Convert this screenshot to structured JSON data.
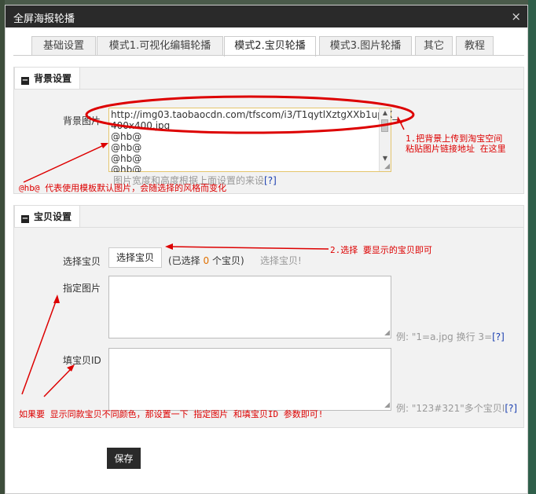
{
  "window": {
    "title": "全屏海报轮播",
    "close_icon": "×"
  },
  "tabs": [
    {
      "label": "基础设置"
    },
    {
      "label": "模式1.可视化编辑轮播"
    },
    {
      "label": "模式2.宝贝轮播",
      "active": true
    },
    {
      "label": "模式3.图片轮播"
    },
    {
      "label": "其它"
    },
    {
      "label": "教程"
    }
  ],
  "background_section": {
    "title": "背景设置",
    "image_label": "背景图片",
    "textarea_lines": [
      "http://img03.taobaocdn.com/tfscom/i3/T1qytlXztgXXb1upjX_",
      "400x400.jpg",
      "@hb@",
      "@hb@",
      "@hb@",
      "@hb@"
    ],
    "hint_text": "图片宽度和高度根据上面设置的来设",
    "hint_link": "[?]"
  },
  "item_section": {
    "title": "宝贝设置",
    "select_label": "选择宝贝",
    "select_button": "选择宝贝",
    "selected_prefix": "(已选择 ",
    "selected_count": "0",
    "selected_suffix": " 个宝贝)",
    "selected_ghost": "选择宝贝!",
    "image_label": "指定图片",
    "image_hint": "例: \"1=a.jpg 换行 3=",
    "image_hint_link": "[?]",
    "id_label": "填宝贝ID",
    "id_hint": "例: \"123#321\"多个宝贝I",
    "id_hint_link": "[?]"
  },
  "save_button": "保存",
  "annotations": {
    "upload": "1.把背景上传到淘宝空间",
    "upload2": "粘贴图片链接地址 在这里",
    "hb_default": "@hb@ 代表使用模板默认图片，会随选择的风格而变化",
    "select": "2.选择 要显示的宝贝即可",
    "colors": "如果要 显示同款宝贝不同颜色，那设置一下 指定图片 和填宝贝ID 参数即可!"
  },
  "colors": {
    "annotation_red": "#dd0000",
    "count_orange": "#e07000",
    "title_bar": "#2a2a2a"
  }
}
